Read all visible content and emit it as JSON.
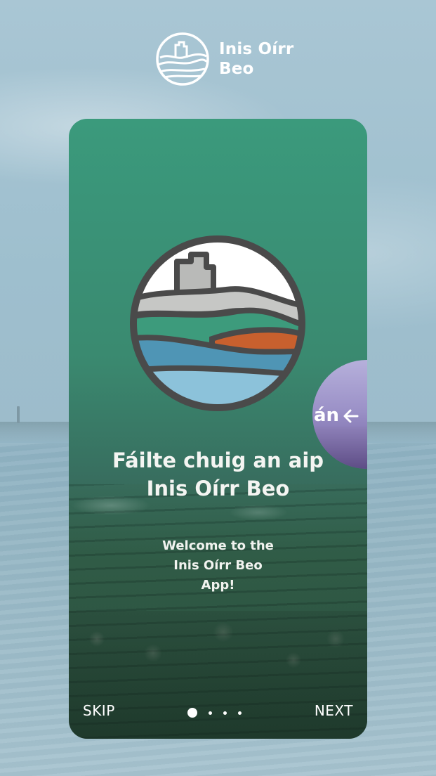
{
  "app": {
    "logo_line1": "Inis Oírr",
    "logo_line2": "Beo"
  },
  "slide": {
    "title_line1": "Fáilte chuig an aip",
    "title_line2": "Inis Oírr Beo",
    "subtitle_line1": "Welcome to the",
    "subtitle_line2": "Inis Oírr Beo",
    "subtitle_line3": "App!",
    "peek_label": "án"
  },
  "nav": {
    "skip_label": "SKIP",
    "next_label": "NEXT",
    "page_count": 4,
    "active_index": 0
  },
  "colors": {
    "card_green": "#3a9277",
    "emblem_outline": "#4a4a4a",
    "emblem_sky": "#ffffff",
    "emblem_castle": "#b9bab8",
    "emblem_green": "#3d9b7c",
    "emblem_orange": "#c8602e",
    "emblem_blue": "#4f95b5",
    "emblem_lightblue": "#8cc2da"
  }
}
